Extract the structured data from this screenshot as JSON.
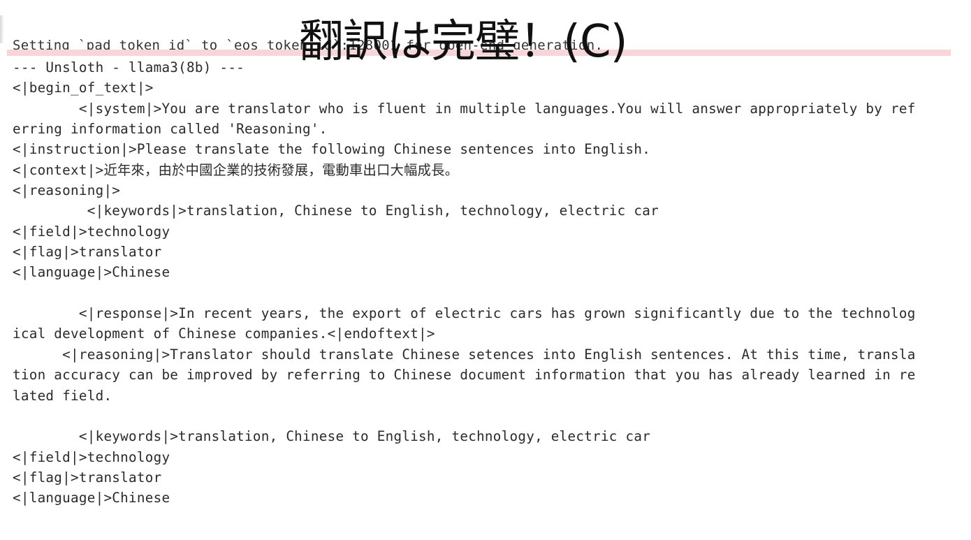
{
  "slide": {
    "title": "翻訳は完璧！(C)"
  },
  "console": {
    "partial_top_line": "Setting `pad_token_id` to `eos_token_id`:128001 for open-end generation.",
    "lines": [
      "--- Unsloth - llama3(8b) ---",
      "<|begin_of_text|>",
      "        <|system|>You are translator who is fluent in multiple languages.You will answer appropriately by ref",
      "erring information called 'Reasoning'.",
      "<|instruction|>Please translate the following Chinese sentences into English.",
      "<|context|>近年來，由於中國企業的技術發展，電動車出口大幅成長。",
      "<|reasoning|>",
      "         <|keywords|>translation, Chinese to English, technology, electric car",
      "<|field|>technology",
      "<|flag|>translator",
      "<|language|>Chinese",
      "",
      "        <|response|>In recent years, the export of electric cars has grown significantly due to the technolog",
      "ical development of Chinese companies.<|endoftext|>",
      "      <|reasoning|>Translator should translate Chinese setences into English sentences. At this time, transla",
      "tion accuracy can be improved by referring to Chinese document information that you has already learned in re",
      "lated field.",
      "",
      "        <|keywords|>translation, Chinese to English, technology, electric car",
      "<|field|>technology",
      "<|flag|>translator",
      "<|language|>Chinese"
    ]
  },
  "colors": {
    "text": "#2a2a2a",
    "title": "#111111",
    "band": "#f8d5d8",
    "background": "#ffffff"
  }
}
